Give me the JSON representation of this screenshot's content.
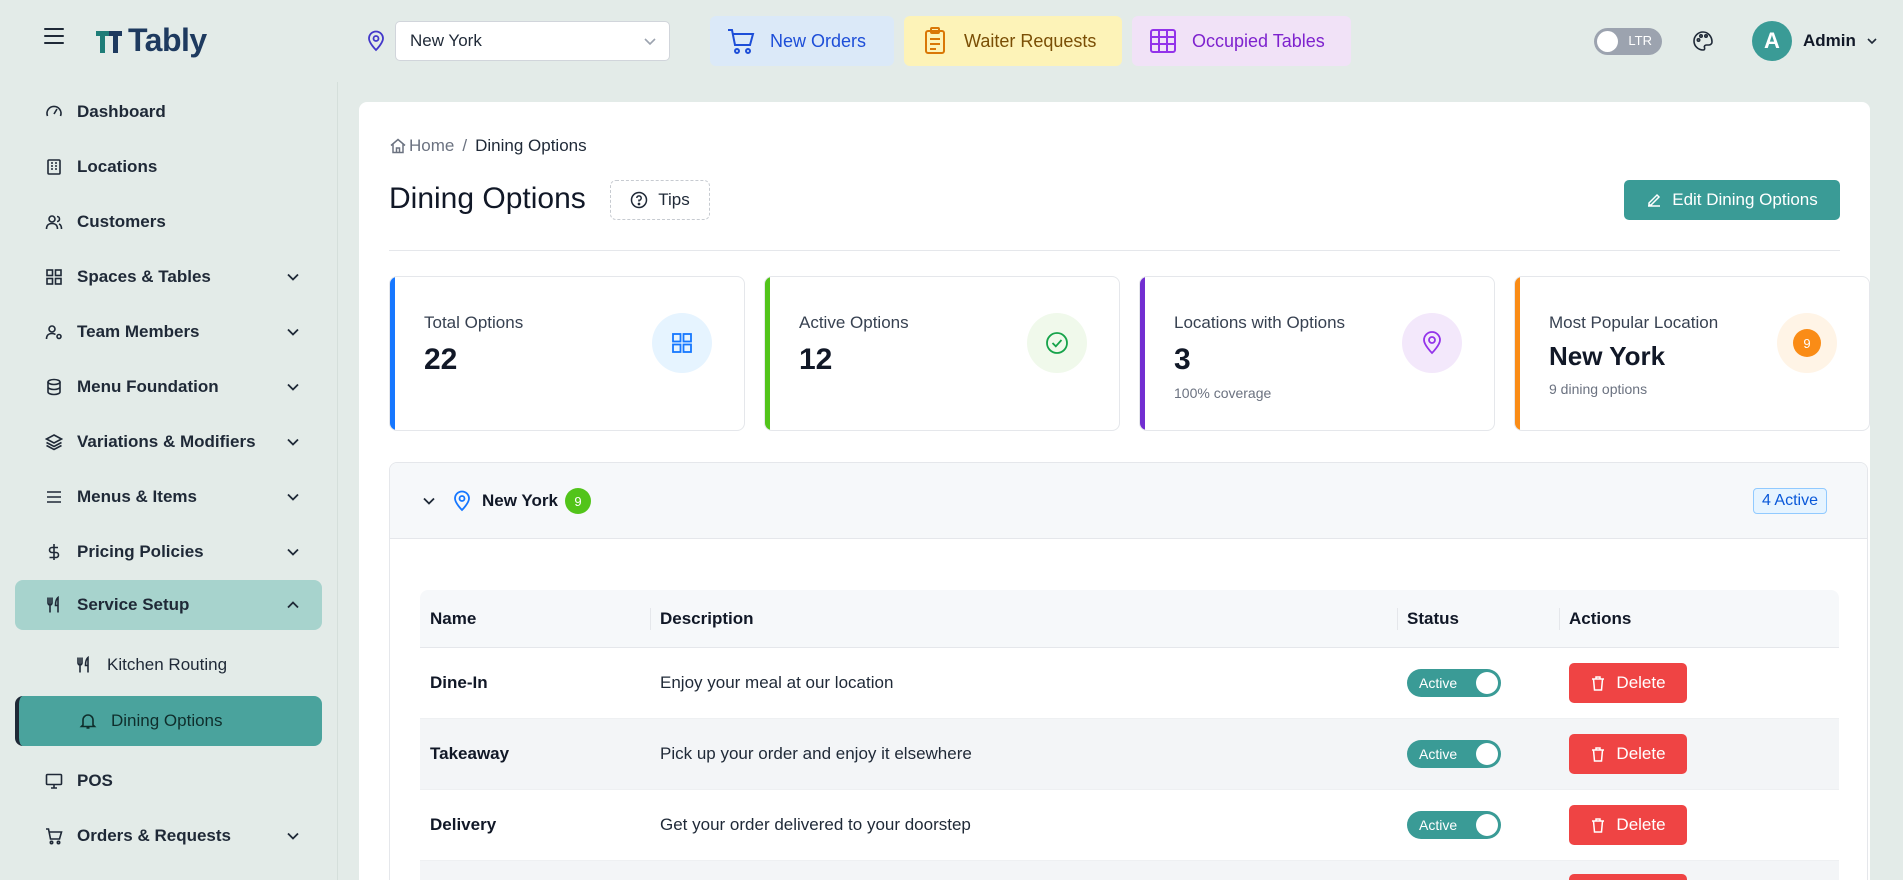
{
  "app": {
    "name": "Tably"
  },
  "header": {
    "location_value": "New York",
    "quick_actions": [
      {
        "label": "New Orders",
        "icon": "cart-icon",
        "color": "#1d4ed8"
      },
      {
        "label": "Waiter Requests",
        "icon": "clipboard-icon",
        "color": "#7a4e05"
      },
      {
        "label": "Occupied Tables",
        "icon": "table-grid-icon",
        "color": "#7e22ce"
      }
    ],
    "direction_toggle": "LTR",
    "user": {
      "initial": "A",
      "name": "Admin"
    }
  },
  "sidebar": {
    "items": [
      {
        "label": "Dashboard",
        "icon": "gauge-icon"
      },
      {
        "label": "Locations",
        "icon": "building-icon"
      },
      {
        "label": "Customers",
        "icon": "users-icon"
      },
      {
        "label": "Spaces & Tables",
        "icon": "grid-icon",
        "expandable": true
      },
      {
        "label": "Team Members",
        "icon": "user-cog-icon",
        "expandable": true
      },
      {
        "label": "Menu Foundation",
        "icon": "database-icon",
        "expandable": true
      },
      {
        "label": "Variations & Modifiers",
        "icon": "layers-icon",
        "expandable": true
      },
      {
        "label": "Menus & Items",
        "icon": "list-icon",
        "expandable": true
      },
      {
        "label": "Pricing Policies",
        "icon": "dollar-icon",
        "expandable": true
      },
      {
        "label": "Service Setup",
        "icon": "utensils-icon",
        "expandable": true,
        "open": true
      },
      {
        "label": "Kitchen Routing",
        "icon": "utensils-icon",
        "sub": true
      },
      {
        "label": "Dining Options",
        "icon": "bell-icon",
        "sub": true,
        "active": true
      },
      {
        "label": "POS",
        "icon": "monitor-icon"
      },
      {
        "label": "Orders & Requests",
        "icon": "cart-icon",
        "expandable": true
      }
    ]
  },
  "breadcrumb": {
    "home": "Home",
    "separator": "/",
    "current": "Dining Options"
  },
  "page": {
    "title": "Dining Options",
    "tips_label": "Tips",
    "edit_label": "Edit Dining Options"
  },
  "stats": [
    {
      "label": "Total Options",
      "value": "22",
      "sub": "",
      "accent": "#1677ff"
    },
    {
      "label": "Active Options",
      "value": "12",
      "sub": "",
      "accent": "#52c41a"
    },
    {
      "label": "Locations with Options",
      "value": "3",
      "sub": "100% coverage",
      "accent": "#722ed1"
    },
    {
      "label": "Most Popular Location",
      "value": "New York",
      "sub": "9 dining options",
      "badge": "9",
      "accent": "#fa8c16"
    }
  ],
  "group": {
    "name": "New York",
    "count": "9",
    "active_tag": "4 Active",
    "columns": [
      "Name",
      "Description",
      "Status",
      "Actions"
    ],
    "rows": [
      {
        "name": "Dine-In",
        "description": "Enjoy your meal at our location",
        "status": "Active",
        "action": "Delete"
      },
      {
        "name": "Takeaway",
        "description": "Pick up your order and enjoy it elsewhere",
        "status": "Active",
        "action": "Delete"
      },
      {
        "name": "Delivery",
        "description": "Get your order delivered to your doorstep",
        "status": "Active",
        "action": "Delete"
      }
    ]
  }
}
